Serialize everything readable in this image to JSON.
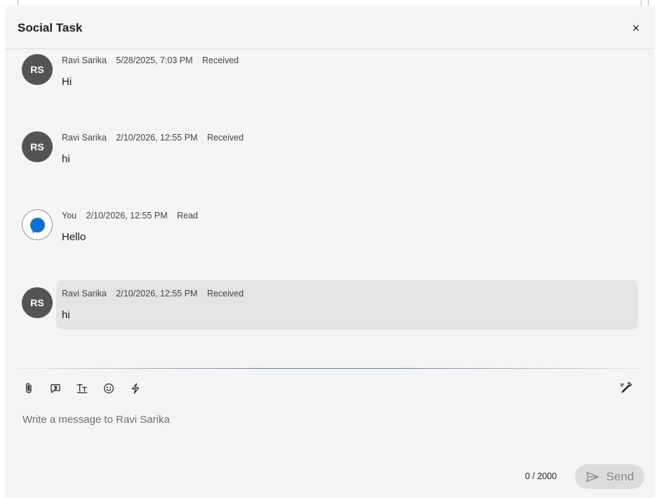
{
  "dialog": {
    "title": "Social Task",
    "close_label": "×"
  },
  "messages": [
    {
      "initials": "RS",
      "sender": "Ravi Sarika",
      "timestamp": "5/28/2025, 7:03 PM",
      "status": "Received",
      "text": "Hi"
    },
    {
      "initials": "RS",
      "sender": "Ravi Sarika",
      "timestamp": "2/10/2026, 12:55 PM",
      "status": "Received",
      "text": "hi"
    },
    {
      "initials": "",
      "sender": "You",
      "timestamp": "2/10/2026, 12:55 PM",
      "status": "Read",
      "text": "Hello"
    },
    {
      "initials": "RS",
      "sender": "Ravi Sarika",
      "timestamp": "2/10/2026, 12:55 PM",
      "status": "Received",
      "text": "hi"
    }
  ],
  "composer": {
    "placeholder": "Write a message to Ravi Sarika",
    "counter": "0 / 2000",
    "send_label": "Send",
    "tools": [
      "attachment-icon",
      "quick-reply-icon",
      "text-format-icon",
      "emoji-icon",
      "lightning-icon"
    ]
  },
  "colors": {
    "avatar": "#545454",
    "you_avatar_accent": "#1170cf",
    "highlight_bubble": "#e4e4e4",
    "panel": "#f4f4f4"
  }
}
